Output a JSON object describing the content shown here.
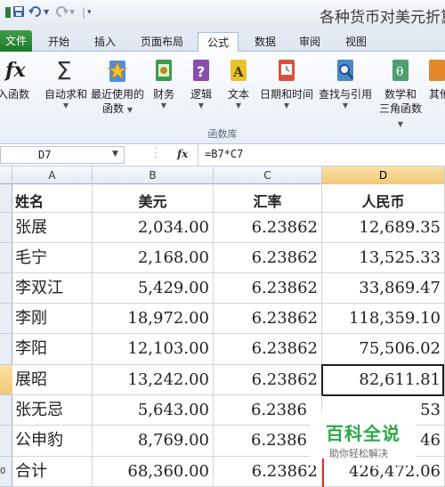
{
  "title_bar": {
    "doc_title": "各种货币对美元折算",
    "save_icon": "save-icon",
    "undo_icon": "undo-icon",
    "redo_icon": "redo-icon"
  },
  "ribbon_tabs": [
    "文件",
    "开始",
    "插入",
    "页面布局",
    "公式",
    "数据",
    "审阅",
    "视图"
  ],
  "active_tab": "公式",
  "ribbon_buttons": [
    {
      "label": "入函数",
      "label2": "",
      "icon": "insert-function-icon"
    },
    {
      "label": "自动求和",
      "label2": "",
      "icon": "sigma-icon",
      "caret": "▼"
    },
    {
      "label": "最近使用的",
      "label2": "函数",
      "icon": "star-book-icon",
      "caret": "▼"
    },
    {
      "label": "财务",
      "label2": "",
      "icon": "finance-book-icon",
      "caret": "▼"
    },
    {
      "label": "逻辑",
      "label2": "",
      "icon": "logic-book-icon",
      "caret": "▼"
    },
    {
      "label": "文本",
      "label2": "",
      "icon": "text-book-icon",
      "caret": "▼"
    },
    {
      "label": "日期和时间",
      "label2": "",
      "icon": "date-time-book-icon",
      "caret": "▼"
    },
    {
      "label": "查找与引用",
      "label2": "",
      "icon": "lookup-book-icon",
      "caret": "▼"
    },
    {
      "label": "数学和",
      "label2": "三角函数",
      "icon": "math-book-icon",
      "caret": "▼"
    },
    {
      "label": "其他",
      "label2": "",
      "icon": "more-book-icon"
    }
  ],
  "group_label": "函数库",
  "formula_bar": {
    "cell_ref": "D7",
    "fx_label": "fx",
    "formula": "=B7*C7"
  },
  "columns": [
    "A",
    "B",
    "C",
    "D"
  ],
  "row_numbers": [
    "",
    "",
    "",
    "",
    "",
    "",
    "",
    "",
    "0"
  ],
  "headers": [
    "姓名",
    "美元",
    "汇率",
    "人民币"
  ],
  "rows": [
    [
      "张展",
      "2,034.00",
      "6.23862",
      "12,689.35"
    ],
    [
      "毛宁",
      "2,168.00",
      "6.23862",
      "13,525.33"
    ],
    [
      "李双江",
      "5,429.00",
      "6.23862",
      "33,869.47"
    ],
    [
      "李刚",
      "18,972.00",
      "6.23862",
      "118,359.10"
    ],
    [
      "李阳",
      "12,103.00",
      "6.23862",
      "75,506.02"
    ],
    [
      "展昭",
      "13,242.00",
      "6.23862",
      "82,611.81"
    ],
    [
      "张无忌",
      "5,643.00",
      "6.2386",
      "53"
    ],
    [
      "公申豹",
      "8,769.00",
      "6.2386",
      "46"
    ],
    [
      "合计",
      "68,360.00",
      "6.23862",
      "426,472.06"
    ]
  ],
  "watermark": {
    "big": "百科全说",
    "small": "助你轻松解决"
  }
}
